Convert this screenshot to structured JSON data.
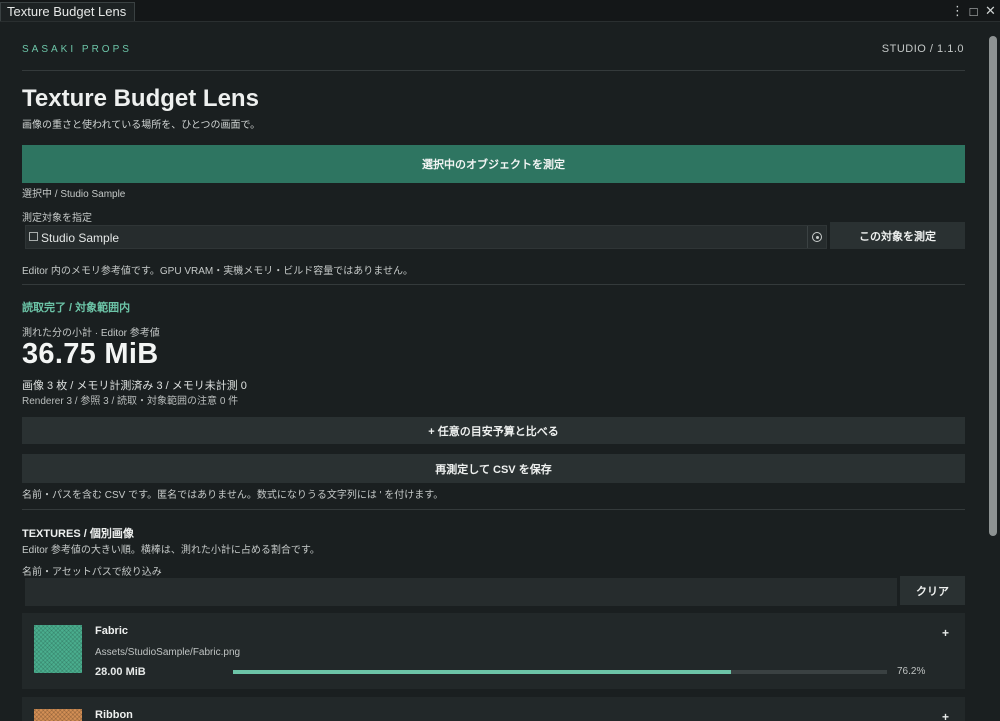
{
  "window": {
    "tab_title": "Texture Budget Lens",
    "controls": [
      "kebab-menu-icon",
      "maximize-icon",
      "close-icon"
    ],
    "controls_glyphs": [
      "⋮",
      "□",
      "✕"
    ]
  },
  "header": {
    "brand": "SASAKI PROPS",
    "version": "STUDIO / 1.1.0",
    "title": "Texture Budget Lens",
    "subtitle": "画像の重さと使われている場所を、ひとつの画面で。"
  },
  "measure": {
    "primary_button": "選択中のオブジェクトを測定",
    "selection_label": "選択中 / Studio Sample",
    "target_label": "測定対象を指定",
    "target_value": "Studio Sample",
    "target_button": "この対象を測定",
    "note": "Editor 内のメモリ参考値です。GPU VRAM・実機メモリ・ビルド容量ではありません。"
  },
  "result": {
    "status": "読取完了 / 対象範囲内",
    "subtotal_label": "測れた分の小計 · Editor 参考値",
    "total": "36.75 MiB",
    "counts": "画像 3 枚  /  メモリ計測済み 3  /  メモリ未計測 0",
    "sub_counts": "Renderer 3  /  参照 3  /  読取・対象範囲の注意 0 件",
    "budget_button": "+ 任意の目安予算と比べる",
    "csv_button": "再測定して CSV を保存",
    "csv_note": "名前・パスを含む CSV です。匿名ではありません。数式になりうる文字列には ' を付けます。"
  },
  "textures": {
    "heading": "TEXTURES / 個別画像",
    "description": "Editor 参考値の大きい順。横棒は、測れた小計に占める割合です。",
    "filter_label": "名前・アセットパスで絞り込み",
    "filter_value": "",
    "clear_button": "クリア",
    "items": [
      {
        "name": "Fabric",
        "path": "Assets/StudioSample/Fabric.png",
        "size": "28.00 MiB",
        "percent_label": "76.2%",
        "fraction": 0.762,
        "thumb_color": "#4aae8e",
        "expand": "+"
      },
      {
        "name": "Ribbon",
        "path": "",
        "size": "",
        "percent_label": "",
        "fraction": 0,
        "thumb_color": "#d38f55",
        "expand": "+"
      }
    ]
  },
  "colors": {
    "accent": "#6cc4a7",
    "primary_button": "#2e7561",
    "background": "#1a1f20"
  }
}
